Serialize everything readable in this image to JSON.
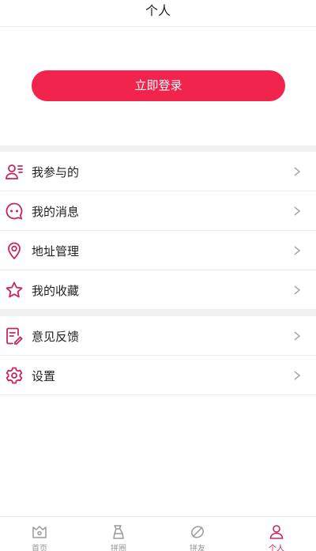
{
  "header": {
    "title": "个人"
  },
  "login": {
    "label": "立即登录"
  },
  "menu_group1": [
    {
      "label": "我参与的",
      "icon": "user-list-icon"
    },
    {
      "label": "我的消息",
      "icon": "message-icon"
    },
    {
      "label": "地址管理",
      "icon": "location-icon"
    },
    {
      "label": "我的收藏",
      "icon": "star-icon"
    }
  ],
  "menu_group2": [
    {
      "label": "意见反馈",
      "icon": "feedback-icon"
    },
    {
      "label": "设置",
      "icon": "gear-icon"
    }
  ],
  "tabs": [
    {
      "label": "首页",
      "icon": "home-icon",
      "active": false
    },
    {
      "label": "拼圈",
      "icon": "circle-icon",
      "active": false
    },
    {
      "label": "拼友",
      "icon": "friends-icon",
      "active": false
    },
    {
      "label": "个人",
      "icon": "person-icon",
      "active": true
    }
  ],
  "colors": {
    "accent": "#f0244c",
    "icon": "#c8265a",
    "divider": "#f1f1f3"
  }
}
